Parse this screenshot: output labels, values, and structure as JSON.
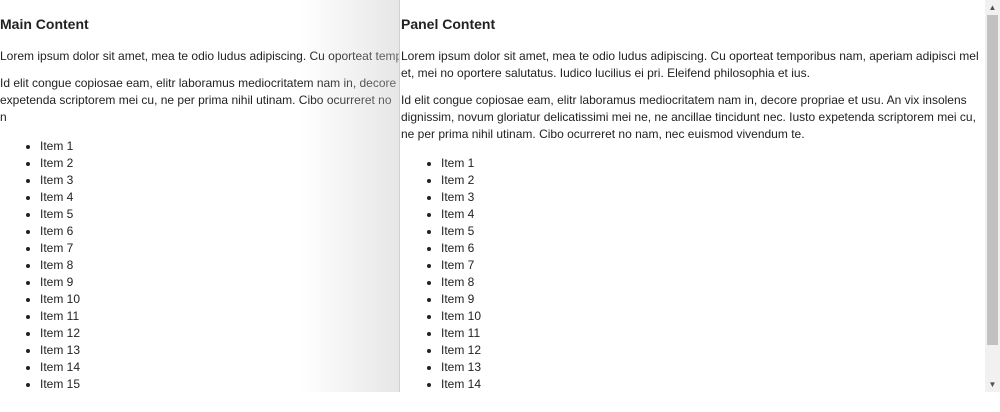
{
  "main": {
    "title": "Main Content",
    "paragraph1": "Lorem ipsum dolor sit amet, mea te odio ludus adipiscing. Cu oporteat temp",
    "paragraph2": "Id elit congue copiosae eam, elitr laboramus mediocritatem nam in, decore expetenda scriptorem mei cu, ne per prima nihil utinam. Cibo ocurreret no n",
    "items": [
      "Item 1",
      "Item 2",
      "Item 3",
      "Item 4",
      "Item 5",
      "Item 6",
      "Item 7",
      "Item 8",
      "Item 9",
      "Item 10",
      "Item 11",
      "Item 12",
      "Item 13",
      "Item 14",
      "Item 15"
    ]
  },
  "panel": {
    "title": "Panel Content",
    "paragraph1": "Lorem ipsum dolor sit amet, mea te odio ludus adipiscing. Cu oporteat temporibus nam, aperiam adipisci mel et, mei no oportere salutatus. Iudico lucilius ei pri. Eleifend philosophia et ius.",
    "paragraph2": "Id elit congue copiosae eam, elitr laboramus mediocritatem nam in, decore propriae et usu. An vix insolens dignissim, novum gloriatur delicatissimi mei ne, ne ancillae tincidunt nec. Iusto expetenda scriptorem mei cu, ne per prima nihil utinam. Cibo ocurreret no nam, nec euismod vivendum te.",
    "items": [
      "Item 1",
      "Item 2",
      "Item 3",
      "Item 4",
      "Item 5",
      "Item 6",
      "Item 7",
      "Item 8",
      "Item 9",
      "Item 10",
      "Item 11",
      "Item 12",
      "Item 13",
      "Item 14"
    ]
  },
  "scrollbar": {
    "up_icon": "scroll-up-arrow-icon",
    "down_icon": "scroll-down-arrow-icon",
    "up_glyph": "▲",
    "down_glyph": "▼"
  }
}
